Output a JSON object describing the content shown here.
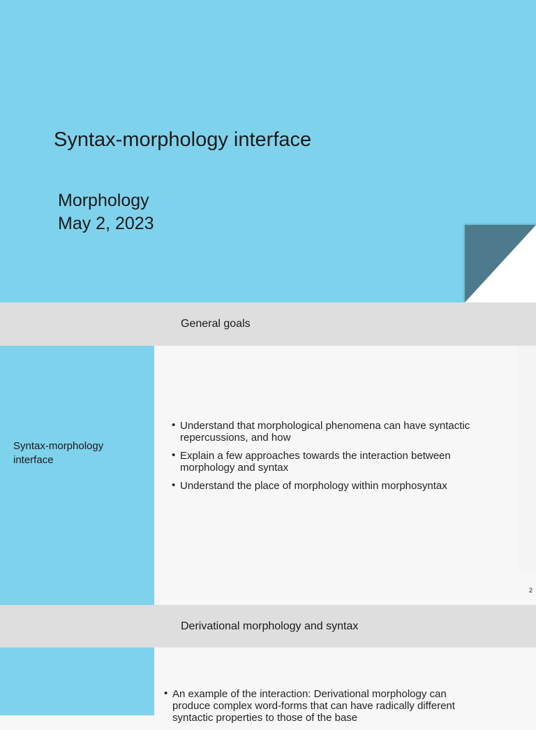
{
  "slide1": {
    "title": "Syntax-morphology interface",
    "course": "Morphology",
    "date": "May 2, 2023"
  },
  "slide2": {
    "header": "General goals",
    "sidebar": "Syntax-morphology interface",
    "bullets": [
      "Understand that morphological phenomena can have syntactic repercussions, and how",
      "Explain a few approaches towards the interaction between morphology and syntax",
      "Understand the place of morphology within morphosyntax"
    ],
    "page_number": "2"
  },
  "slide3": {
    "header": "Derivational morphology and syntax",
    "bullets": [
      "An example of the interaction: Derivational morphology can produce complex word-forms that can have radically different syntactic properties to those of the base"
    ]
  }
}
